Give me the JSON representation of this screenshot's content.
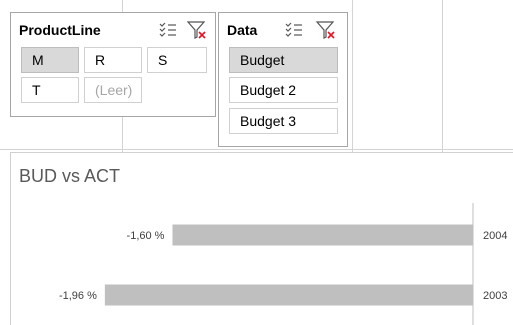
{
  "slicers": {
    "productline": {
      "title": "ProductLine",
      "items": [
        {
          "label": "M",
          "selected": true
        },
        {
          "label": "R",
          "selected": false
        },
        {
          "label": "S",
          "selected": false
        },
        {
          "label": "T",
          "selected": false
        },
        {
          "label": "(Leer)",
          "selected": false,
          "disabled": true
        }
      ],
      "icons": [
        "multi-select-icon",
        "clear-filter-icon"
      ]
    },
    "data": {
      "title": "Data",
      "items": [
        {
          "label": "Budget",
          "selected": true
        },
        {
          "label": "Budget 2",
          "selected": false
        },
        {
          "label": "Budget 3",
          "selected": false
        }
      ],
      "icons": [
        "multi-select-icon",
        "clear-filter-icon"
      ]
    }
  },
  "colors": {
    "bar": "#bfbfbf",
    "selected_item": "#d9d9d9",
    "clear_filter_x": "#e81123",
    "axis": "#bfbfbf"
  },
  "chart_data": {
    "type": "bar",
    "orientation": "horizontal",
    "title": "BUD vs ACT",
    "categories": [
      "2004",
      "2003"
    ],
    "values": [
      -1.6,
      -1.96
    ],
    "value_labels": [
      "-1,60 %",
      "-1,96 %"
    ],
    "xlim": [
      -2.3,
      0
    ]
  }
}
